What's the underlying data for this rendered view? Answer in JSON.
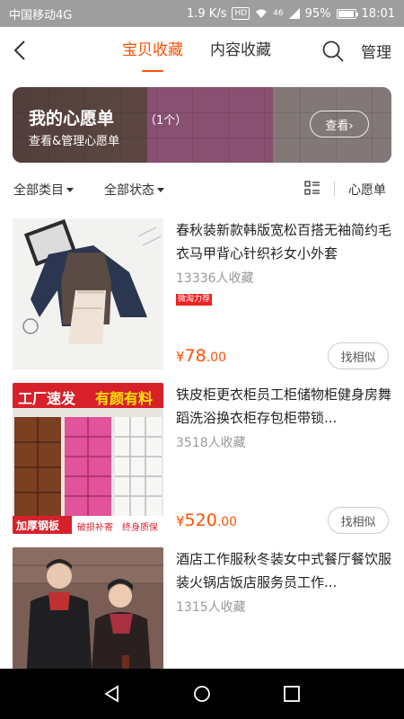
{
  "status_bar": {
    "carrier": "中国移动4G",
    "speed": "1.9 K/s",
    "hd": "HD",
    "signal": "46",
    "battery": "95%",
    "time": "18:01"
  },
  "nav": {
    "tabs": [
      {
        "label": "宝贝收藏"
      },
      {
        "label": "内容收藏"
      }
    ],
    "manage_label": "管理",
    "active_tab": "宝贝收藏"
  },
  "wishlist": {
    "title": "我的心愿单",
    "count": "（1个）",
    "subtitle": "查看&管理心愿单",
    "button": "查看›"
  },
  "filter": {
    "category": "全部类目",
    "status": "全部状态",
    "wishlist": "心愿单"
  },
  "products": [
    {
      "title": "春秋装新款韩版宽松百搭无袖简约毛衣马甲背心针织衫女小外套",
      "favorites": "13336人收藏",
      "badge": "微淘力荐",
      "currency": "¥",
      "price_int": "78",
      "price_dec": ".00",
      "similar": "找相似"
    },
    {
      "title": "铁皮柜更衣柜员工柜储物柜健身房舞蹈洗浴换衣柜存包柜带锁...",
      "favorites": "3518人收藏",
      "currency": "¥",
      "price_int": "520",
      "price_dec": ".00",
      "similar": "找相似",
      "image_text": {
        "top_left": "工厂速发",
        "top_right": "有颜有料",
        "bottom_left": "加厚钢板",
        "bottom_mid": "破损补寄",
        "bottom_right": "终身质保"
      }
    },
    {
      "title": "酒店工作服秋冬装女中式餐厅餐饮服装火锅店饭店服务员工作...",
      "favorites": "1315人收藏"
    }
  ],
  "colors": {
    "accent": "#ff5000",
    "status_bar": "#9e9e9e"
  }
}
